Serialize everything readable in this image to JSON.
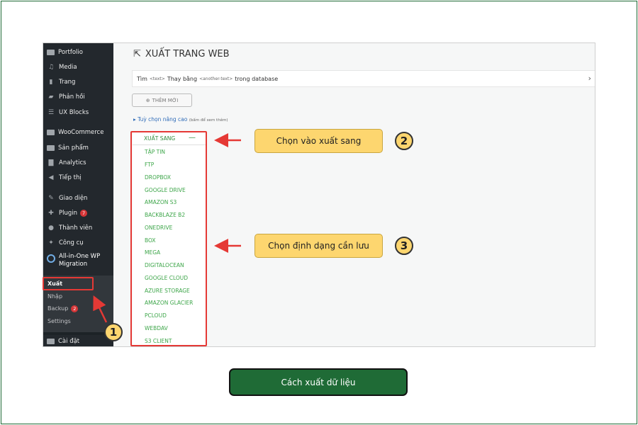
{
  "sidebar": {
    "items": [
      {
        "label": "Portfolio",
        "icon": "portfolio-icon"
      },
      {
        "label": "Media",
        "icon": "media-icon"
      },
      {
        "label": "Trang",
        "icon": "page-icon"
      },
      {
        "label": "Phản hồi",
        "icon": "comment-icon"
      },
      {
        "label": "UX Blocks",
        "icon": "blocks-icon"
      },
      {
        "label": "WooCommerce",
        "icon": "woocommerce-icon"
      },
      {
        "label": "Sản phẩm",
        "icon": "product-icon"
      },
      {
        "label": "Analytics",
        "icon": "analytics-icon"
      },
      {
        "label": "Tiếp thị",
        "icon": "megaphone-icon"
      },
      {
        "label": "Giao diện",
        "icon": "brush-icon"
      },
      {
        "label": "Plugin",
        "icon": "plugin-icon",
        "badge": "7"
      },
      {
        "label": "Thành viên",
        "icon": "user-icon"
      },
      {
        "label": "Công cụ",
        "icon": "wrench-icon"
      }
    ],
    "active": {
      "label_line1": "All-in-One WP",
      "label_line2": "Migration"
    },
    "submenu": [
      {
        "label": "Xuất"
      },
      {
        "label": "Nhập"
      },
      {
        "label": "Backup",
        "badge": "2"
      },
      {
        "label": "Settings"
      }
    ],
    "bottom": {
      "label": "Cài đặt"
    }
  },
  "main": {
    "title": "XUẤT TRANG WEB",
    "findbar": {
      "find": "Tìm",
      "text_tag": "<text>",
      "replace": "Thay bằng",
      "another_tag": "<another-text>",
      "suffix": "trong database"
    },
    "add_button": "THÊM MỚI",
    "advanced": {
      "label": "Tuỳ chọn nâng cao",
      "hint": "(bấm để xem thêm)"
    },
    "export": {
      "header": "XUẤT SANG",
      "options": [
        "TẬP TIN",
        "FTP",
        "DROPBOX",
        "GOOGLE DRIVE",
        "AMAZON S3",
        "BACKBLAZE B2",
        "ONEDRIVE",
        "BOX",
        "MEGA",
        "DIGITALOCEAN",
        "GOOGLE CLOUD",
        "AZURE STORAGE",
        "AMAZON GLACIER",
        "PCLOUD",
        "WEBDAV",
        "S3 CLIENT"
      ]
    }
  },
  "annotations": {
    "step1": "1",
    "step2": "2",
    "step2_text": "Chọn vào xuất sang",
    "step3": "3",
    "step3_text": "Chọn định dạng cần lưu"
  },
  "caption": "Cách xuất dữ liệu",
  "colors": {
    "frame": "#1f6b36",
    "sidebar": "#23282d",
    "callout": "#fdd66f",
    "highlight": "#e53935",
    "option_text": "#3ea64a"
  }
}
